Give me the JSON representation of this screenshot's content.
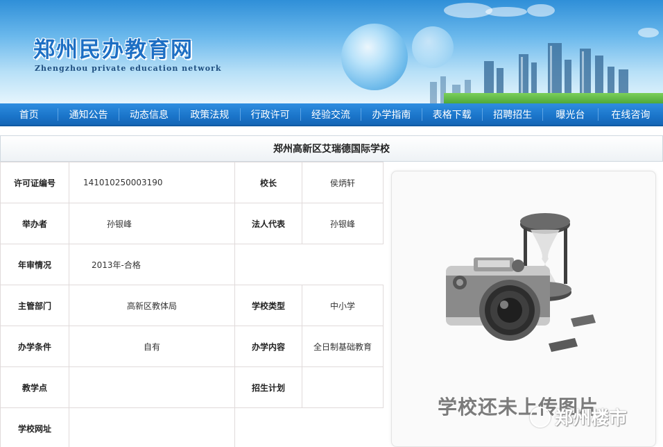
{
  "site": {
    "name_cn": "郑州民办教育网",
    "name_en": "Zhengzhou private education network"
  },
  "nav": {
    "items": [
      "首页",
      "通知公告",
      "动态信息",
      "政策法规",
      "行政许可",
      "经验交流",
      "办学指南",
      "表格下载",
      "招聘招生",
      "曝光台",
      "在线咨询"
    ]
  },
  "school": {
    "name": "郑州高新区艾瑞德国际学校",
    "rows": [
      {
        "l1": "许可证编号",
        "v1": "141010250003190",
        "l2": "校长",
        "v2": "侯炳轩"
      },
      {
        "l1": "举办者",
        "v1": "孙银峰",
        "l2": "法人代表",
        "v2": "孙银峰"
      },
      {
        "l1": "年审情况",
        "v1": "2013年-合格"
      },
      {
        "l1": "主管部门",
        "v1": "高新区教体局",
        "l2": "学校类型",
        "v2": "中小学"
      },
      {
        "l1": "办学条件",
        "v1": "自有",
        "l2": "办学内容",
        "v2": "全日制基础教育"
      },
      {
        "l1": "教学点",
        "v1": "",
        "l2": "招生计划",
        "v2": ""
      },
      {
        "l1": "学校网址",
        "v1": ""
      }
    ]
  },
  "photo": {
    "placeholder_text": "学校还未上传图片",
    "icon": "camera-hourglass-icon"
  },
  "watermark": {
    "text": "郑州楼市",
    "icon": "wechat-icon"
  },
  "colors": {
    "nav_bg": "#1a74c9",
    "banner_title": "#1d6fc4",
    "table_border": "#e0dada"
  }
}
